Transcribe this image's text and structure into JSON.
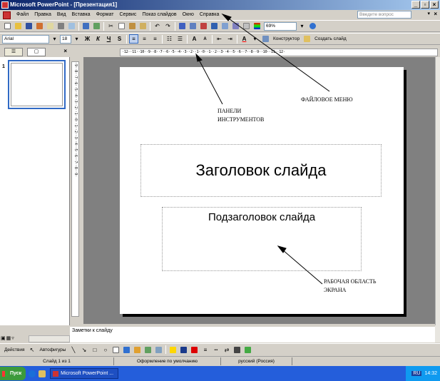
{
  "window": {
    "title": "Microsoft PowerPoint - [Презентация1]",
    "buttons": {
      "minimize": "_",
      "maximize": "▫",
      "close": "×"
    }
  },
  "menu": {
    "items": [
      "Файл",
      "Правка",
      "Вид",
      "Вставка",
      "Формат",
      "Сервис",
      "Показ слайдов",
      "Окно",
      "Справка"
    ],
    "ask_placeholder": "Введите вопрос",
    "close": "×",
    "arrow": "▾"
  },
  "standard_toolbar": {
    "zoom_value": "69%"
  },
  "formatting_toolbar": {
    "font_name": "Arial",
    "font_size": "18",
    "bold": "Ж",
    "italic": "К",
    "underline": "Ч",
    "shadow": "S",
    "increase_font": "A",
    "decrease_font": "A",
    "font_color_label": "A",
    "designer": "Конструктор",
    "new_slide": "Создать слайд"
  },
  "panel": {
    "tab_outline": "☰",
    "tab_slides": "▢",
    "close": "×",
    "slide_number": "1"
  },
  "rulers": {
    "horizontal": "·12··11··10··9··8··7··6··5··4··3··2··1··0··1··2··3··4··5··6··7··8··9··10··11··12·",
    "vertical": "·9··8··7··6··5··4··3··2··1··0··1··2··3··4··5··6··7··8··9·"
  },
  "slide": {
    "title_placeholder": "Заголовок слайда",
    "subtitle_placeholder": "Подзаголовок слайда"
  },
  "annotations": {
    "file_menu": "ФАЙЛОВОЕ МЕНЮ",
    "toolbars_line1": "ПАНЕЛИ",
    "toolbars_line2": "ИНСТРУМЕНТОВ",
    "workspace_line1": "РАБОЧАЯ ОБЛАСТЬ",
    "workspace_line2": "ЭКРАНА"
  },
  "notes": {
    "placeholder": "Заметки к слайду"
  },
  "drawing_toolbar": {
    "actions": "Действия",
    "autoshapes": "Автофигуры"
  },
  "status": {
    "slide_info": "Слайд 1 из 1",
    "design": "Оформление по умолчанию",
    "language": "русский (Россия)"
  },
  "taskbar": {
    "start": "Пуск",
    "task": "Microsoft PowerPoint ...",
    "clock": "14:32",
    "lang": "RU"
  },
  "colors": {
    "title_gradient_start": "#0a246a",
    "taskbar": "#245edb",
    "start_button": "#3c9a3c",
    "selection_border": "#316ac5"
  }
}
